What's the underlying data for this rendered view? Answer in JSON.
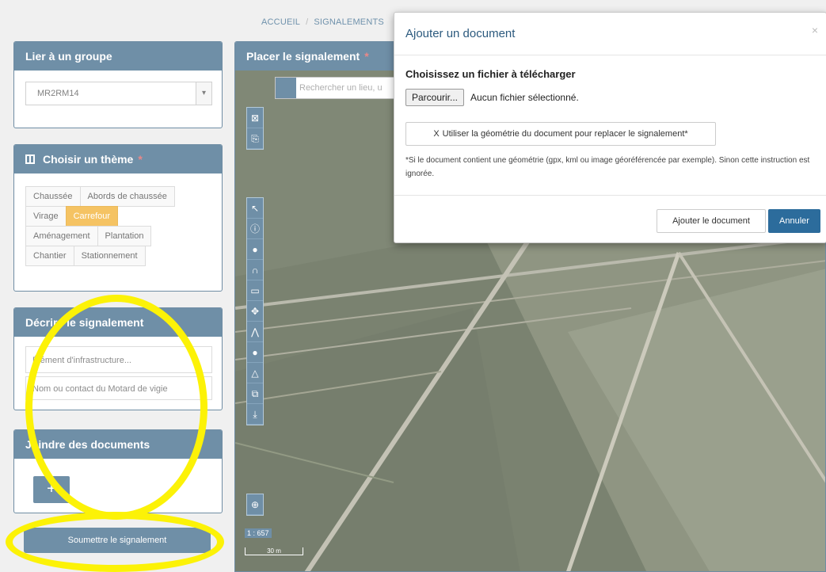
{
  "breadcrumb": {
    "home": "ACCUEIL",
    "separator": "/",
    "current": "SIGNALEMENTS"
  },
  "group_panel": {
    "title": "Lier à un groupe",
    "selected": "MR2RM14"
  },
  "theme_panel": {
    "title": "Choisir un thème",
    "required_mark": "*",
    "rows": [
      [
        "Chaussée",
        "Abords de chaussée"
      ],
      [
        "Virage",
        "Carrefour"
      ],
      [
        "Aménagement",
        "Plantation"
      ],
      [
        "Chantier",
        "Stationnement"
      ]
    ],
    "active": "Carrefour"
  },
  "describe_panel": {
    "title": "Décrire le signalement",
    "field1": "Élément d'infrastructure...",
    "field2": "Nom ou contact du Motard de vigie"
  },
  "docs_panel": {
    "title": "Joindre des documents",
    "add_label": "+"
  },
  "submit_label": "Soumettre le signalement",
  "map": {
    "title": "Placer le signalement",
    "required_mark": "*",
    "search_placeholder": "Rechercher un lieu, u",
    "scale_ratio": "1 : 657",
    "scale_bar": "30 m"
  },
  "modal": {
    "title": "Ajouter un document",
    "close": "×",
    "heading": "Choisissez un fichier à télécharger",
    "browse_label": "Parcourir...",
    "no_file": "Aucun fichier sélectionné.",
    "geometry_check": "X",
    "geometry_label": "Utiliser la géométrie du document pour replacer le signalement*",
    "note": "*Si le document contient une géométrie (gpx, kml ou image géoréférencée par exemple). Sinon cette instruction est ignorée.",
    "add_button": "Ajouter le document",
    "cancel_button": "Annuler"
  },
  "colors": {
    "primary": "#2c5a7e",
    "active_theme": "#f0a71a",
    "annotation": "#fcf207"
  }
}
